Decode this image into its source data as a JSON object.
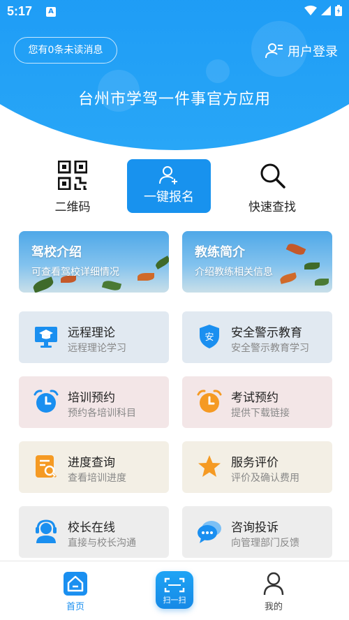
{
  "status_bar": {
    "time": "5:17",
    "notif_letter": "A"
  },
  "header": {
    "unread_messages": "您有0条未读消息",
    "login_label": "用户登录",
    "app_title": "台州市学驾一件事官方应用"
  },
  "quick_actions": {
    "qr_label": "二维码",
    "signup_label": "一键报名",
    "search_label": "快速查找"
  },
  "banners": [
    {
      "title": "驾校介绍",
      "subtitle": "可查看驾校详细情况"
    },
    {
      "title": "教练简介",
      "subtitle": "介绍教练相关信息"
    }
  ],
  "features": [
    {
      "title": "远程理论",
      "subtitle": "远程理论学习",
      "icon": "monitor-graduation-icon",
      "color": "#1a8ff0"
    },
    {
      "title": "安全警示教育",
      "subtitle": "安全警示教育学习",
      "icon": "shield-icon",
      "color": "#1a8ff0"
    },
    {
      "title": "培训预约",
      "subtitle": "预约各培训科目",
      "icon": "alarm-clock-icon",
      "color": "#1a8ff0"
    },
    {
      "title": "考试预约",
      "subtitle": "提供下载链接",
      "icon": "alarm-clock-icon",
      "color": "#f59a23"
    },
    {
      "title": "进度查询",
      "subtitle": "查看培训进度",
      "icon": "document-search-icon",
      "color": "#f59a23"
    },
    {
      "title": "服务评价",
      "subtitle": "评价及确认费用",
      "icon": "star-icon",
      "color": "#f59a23"
    },
    {
      "title": "校长在线",
      "subtitle": "直接与校长沟通",
      "icon": "headset-person-icon",
      "color": "#1a8ff0"
    },
    {
      "title": "咨询投诉",
      "subtitle": "向管理部门反馈",
      "icon": "chat-bubbles-icon",
      "color": "#1a8ff0"
    }
  ],
  "shield_text": "安",
  "bottom_nav": {
    "home_label": "首页",
    "scan_label": "扫一扫",
    "mine_label": "我的"
  }
}
